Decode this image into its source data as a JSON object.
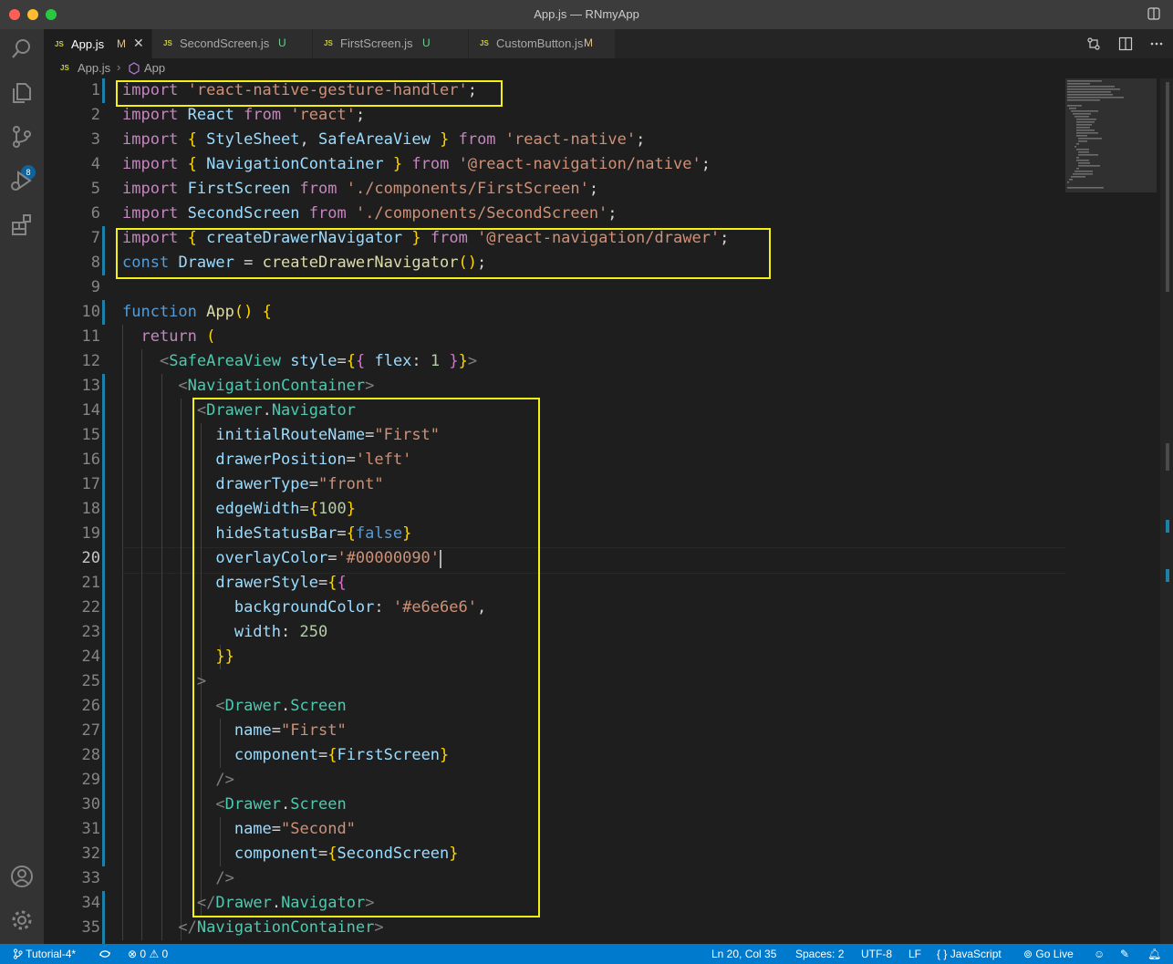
{
  "window": {
    "title": "App.js — RNmyApp"
  },
  "activity_bar": {
    "icons": [
      "search-icon",
      "files-icon",
      "source-control-icon",
      "run-debug-icon",
      "extensions-icon",
      "account-icon",
      "settings-gear-icon"
    ],
    "source_control_badge": "8"
  },
  "tabs": [
    {
      "lang": "JS",
      "label": "App.js",
      "status": "M",
      "status_color": "#e2c08d",
      "active": true
    },
    {
      "lang": "JS",
      "label": "SecondScreen.js",
      "status": "U",
      "status_color": "#73c991",
      "active": false
    },
    {
      "lang": "JS",
      "label": "FirstScreen.js",
      "status": "U",
      "status_color": "#73c991",
      "active": false
    },
    {
      "lang": "JS",
      "label": "CustomButton.js",
      "status": "M",
      "status_color": "#e2c08d",
      "active": false
    }
  ],
  "breadcrumb": {
    "lang": "JS",
    "file": "App.js",
    "symbol": "App"
  },
  "editor": {
    "current_line": "20",
    "lines": [
      {
        "n": "1",
        "text": "import 'react-native-gesture-handler';"
      },
      {
        "n": "2",
        "text": "import React from 'react';"
      },
      {
        "n": "3",
        "text": "import { StyleSheet, SafeAreaView } from 'react-native';"
      },
      {
        "n": "4",
        "text": "import { NavigationContainer } from '@react-navigation/native';"
      },
      {
        "n": "5",
        "text": "import FirstScreen from './components/FirstScreen';"
      },
      {
        "n": "6",
        "text": "import SecondScreen from './components/SecondScreen';"
      },
      {
        "n": "7",
        "text": "import { createDrawerNavigator } from '@react-navigation/drawer';"
      },
      {
        "n": "8",
        "text": "const Drawer = createDrawerNavigator();"
      },
      {
        "n": "9",
        "text": ""
      },
      {
        "n": "10",
        "text": "function App() {"
      },
      {
        "n": "11",
        "text": "  return ("
      },
      {
        "n": "12",
        "text": "    <SafeAreaView style={{ flex: 1 }}>"
      },
      {
        "n": "13",
        "text": "      <NavigationContainer>"
      },
      {
        "n": "14",
        "text": "        <Drawer.Navigator"
      },
      {
        "n": "15",
        "text": "          initialRouteName=\"First\""
      },
      {
        "n": "16",
        "text": "          drawerPosition='left'"
      },
      {
        "n": "17",
        "text": "          drawerType=\"front\""
      },
      {
        "n": "18",
        "text": "          edgeWidth={100}"
      },
      {
        "n": "19",
        "text": "          hideStatusBar={false}"
      },
      {
        "n": "20",
        "text": "          overlayColor='#00000090'"
      },
      {
        "n": "21",
        "text": "          drawerStyle={{"
      },
      {
        "n": "22",
        "text": "            backgroundColor: '#e6e6e6',"
      },
      {
        "n": "23",
        "text": "            width: 250"
      },
      {
        "n": "24",
        "text": "          }}"
      },
      {
        "n": "25",
        "text": "        >"
      },
      {
        "n": "26",
        "text": "          <Drawer.Screen"
      },
      {
        "n": "27",
        "text": "            name=\"First\""
      },
      {
        "n": "28",
        "text": "            component={FirstScreen}"
      },
      {
        "n": "29",
        "text": "          />"
      },
      {
        "n": "30",
        "text": "          <Drawer.Screen"
      },
      {
        "n": "31",
        "text": "            name=\"Second\""
      },
      {
        "n": "32",
        "text": "            component={SecondScreen}"
      },
      {
        "n": "33",
        "text": "          />"
      },
      {
        "n": "34",
        "text": "        </Drawer.Navigator>"
      },
      {
        "n": "35",
        "text": "      </NavigationContainer>"
      }
    ]
  },
  "status_bar": {
    "branch": "Tutorial-4*",
    "errors": "0",
    "warnings": "0",
    "cursor_position": "Ln 20, Col 35",
    "indentation": "Spaces: 2",
    "encoding": "UTF-8",
    "eol": "LF",
    "language": "JavaScript",
    "go_live": "Go Live"
  },
  "colors": {
    "highlight_box": "#f4f013",
    "status_bar": "#007acc",
    "activity_bar": "#333333",
    "editor_bg": "#1e1e1e"
  }
}
